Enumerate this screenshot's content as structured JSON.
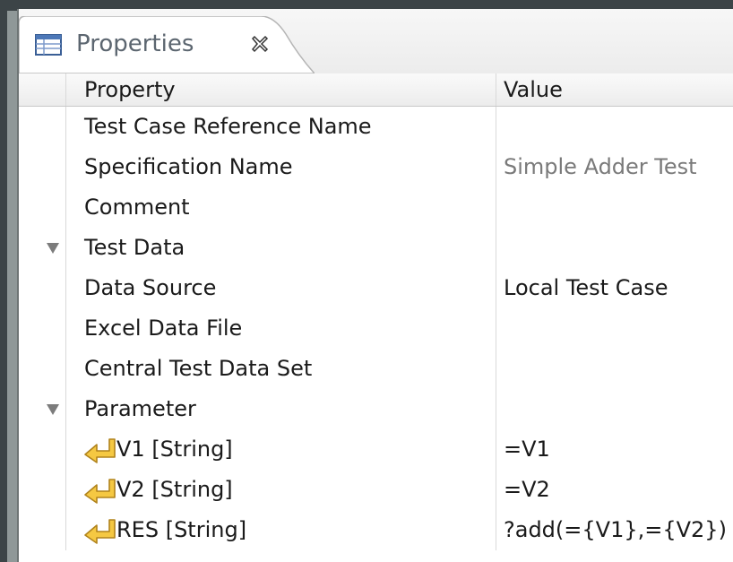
{
  "view": {
    "tab_title": "Properties",
    "tab_icon": "properties-table-icon",
    "close_icon": "close-x-icon"
  },
  "table": {
    "columns": [
      "Property",
      "Value"
    ],
    "rows": [
      {
        "property": "Test Case Reference Name",
        "value": ""
      },
      {
        "property": "Specification Name",
        "value": "Simple Adder Test"
      },
      {
        "property": "Comment",
        "value": ""
      },
      {
        "property": "Test Data",
        "value": ""
      },
      {
        "property": "Data Source",
        "value": "Local Test Case"
      },
      {
        "property": "Excel Data File",
        "value": ""
      },
      {
        "property": "Central Test Data Set",
        "value": ""
      },
      {
        "property": "Parameter",
        "value": ""
      },
      {
        "property": "V1 [String]",
        "value": "=V1"
      },
      {
        "property": "V2 [String]",
        "value": "=V2"
      },
      {
        "property": "RES [String]",
        "value": "?add(={V1},={V2})"
      }
    ]
  },
  "icons": {
    "tree_expand": "triangle-down-icon",
    "parameter": "parameter-arrow-icon"
  },
  "colors": {
    "parameter_icon": "#f5c842",
    "muted_value": "#7a7a7a"
  }
}
